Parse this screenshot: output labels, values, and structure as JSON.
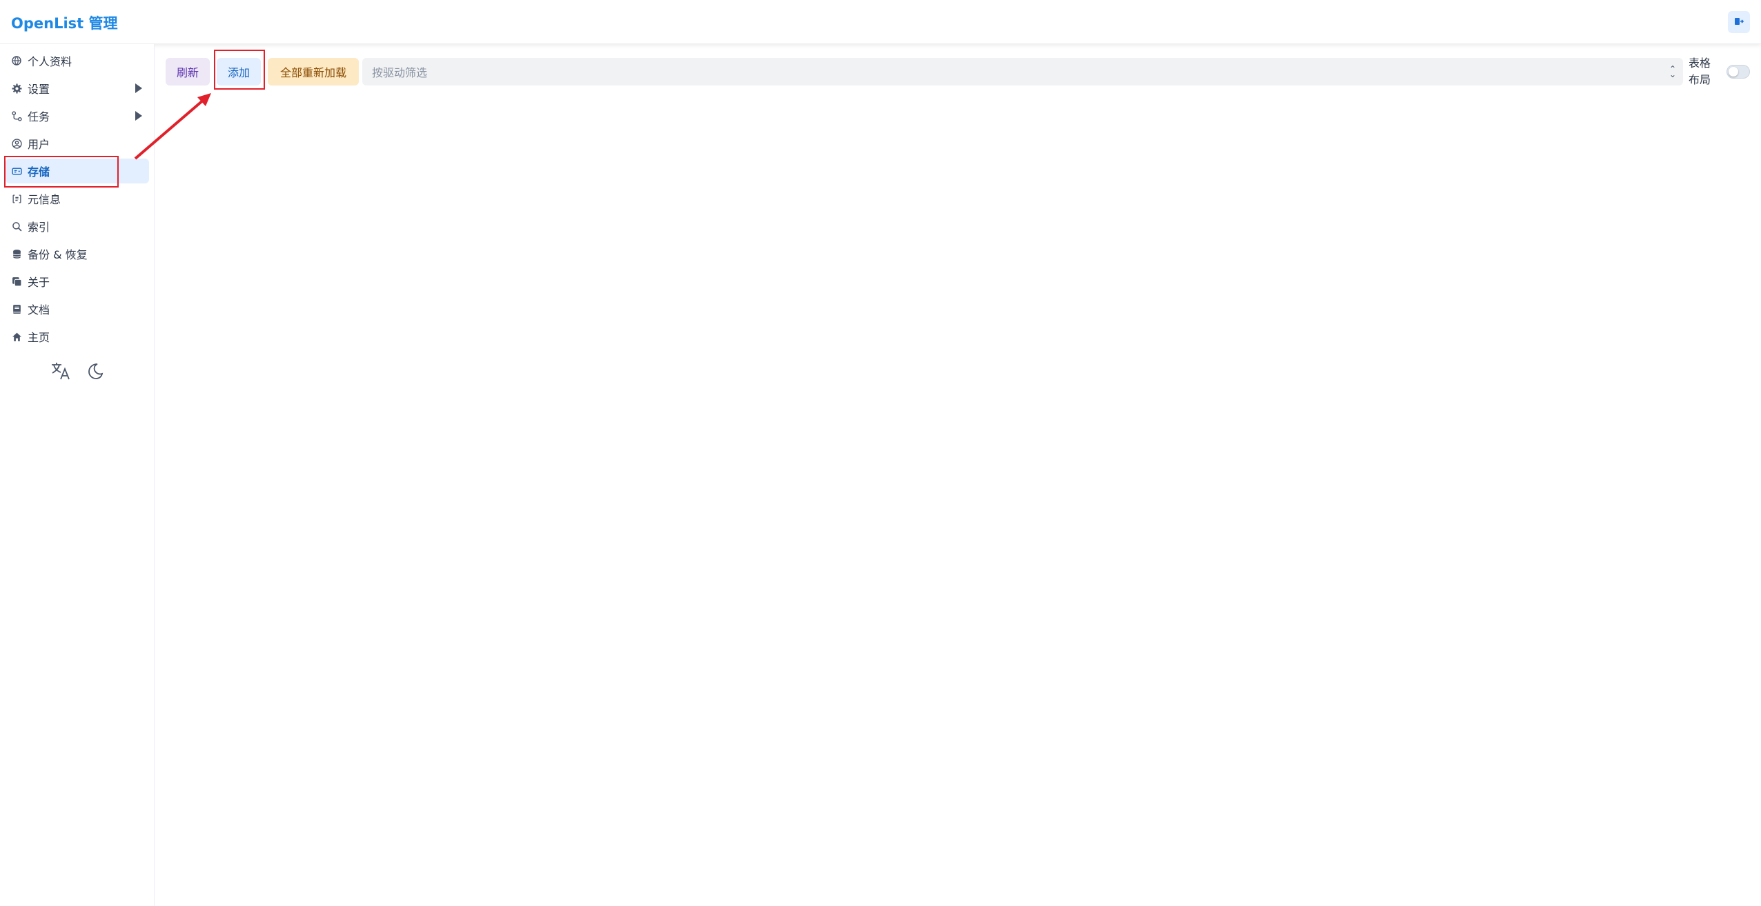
{
  "header": {
    "title": "OpenList 管理",
    "logout_icon": "logout-icon"
  },
  "sidebar": {
    "items": [
      {
        "label": "个人资料",
        "icon": "globe-icon"
      },
      {
        "label": "设置",
        "icon": "gear-icon",
        "expandable": true
      },
      {
        "label": "任务",
        "icon": "git-branch-icon",
        "expandable": true
      },
      {
        "label": "用户",
        "icon": "user-circle-icon"
      },
      {
        "label": "存储",
        "icon": "storage-icon",
        "active": true
      },
      {
        "label": "元信息",
        "icon": "metadata-icon"
      },
      {
        "label": "索引",
        "icon": "search-icon"
      },
      {
        "label": "备份 & 恢复",
        "icon": "database-icon"
      },
      {
        "label": "关于",
        "icon": "copy-icon"
      },
      {
        "label": "文档",
        "icon": "book-icon"
      },
      {
        "label": "主页",
        "icon": "home-icon"
      }
    ],
    "tools": [
      "translate-icon",
      "moon-icon"
    ]
  },
  "toolbar": {
    "refresh_label": "刷新",
    "add_label": "添加",
    "reload_all_label": "全部重新加载",
    "filter_placeholder": "按驱动筛选",
    "layout_label": "表格布局",
    "table_layout_enabled": false
  },
  "colors": {
    "accent": "#1e88e5",
    "annotation": "#e0202a"
  }
}
